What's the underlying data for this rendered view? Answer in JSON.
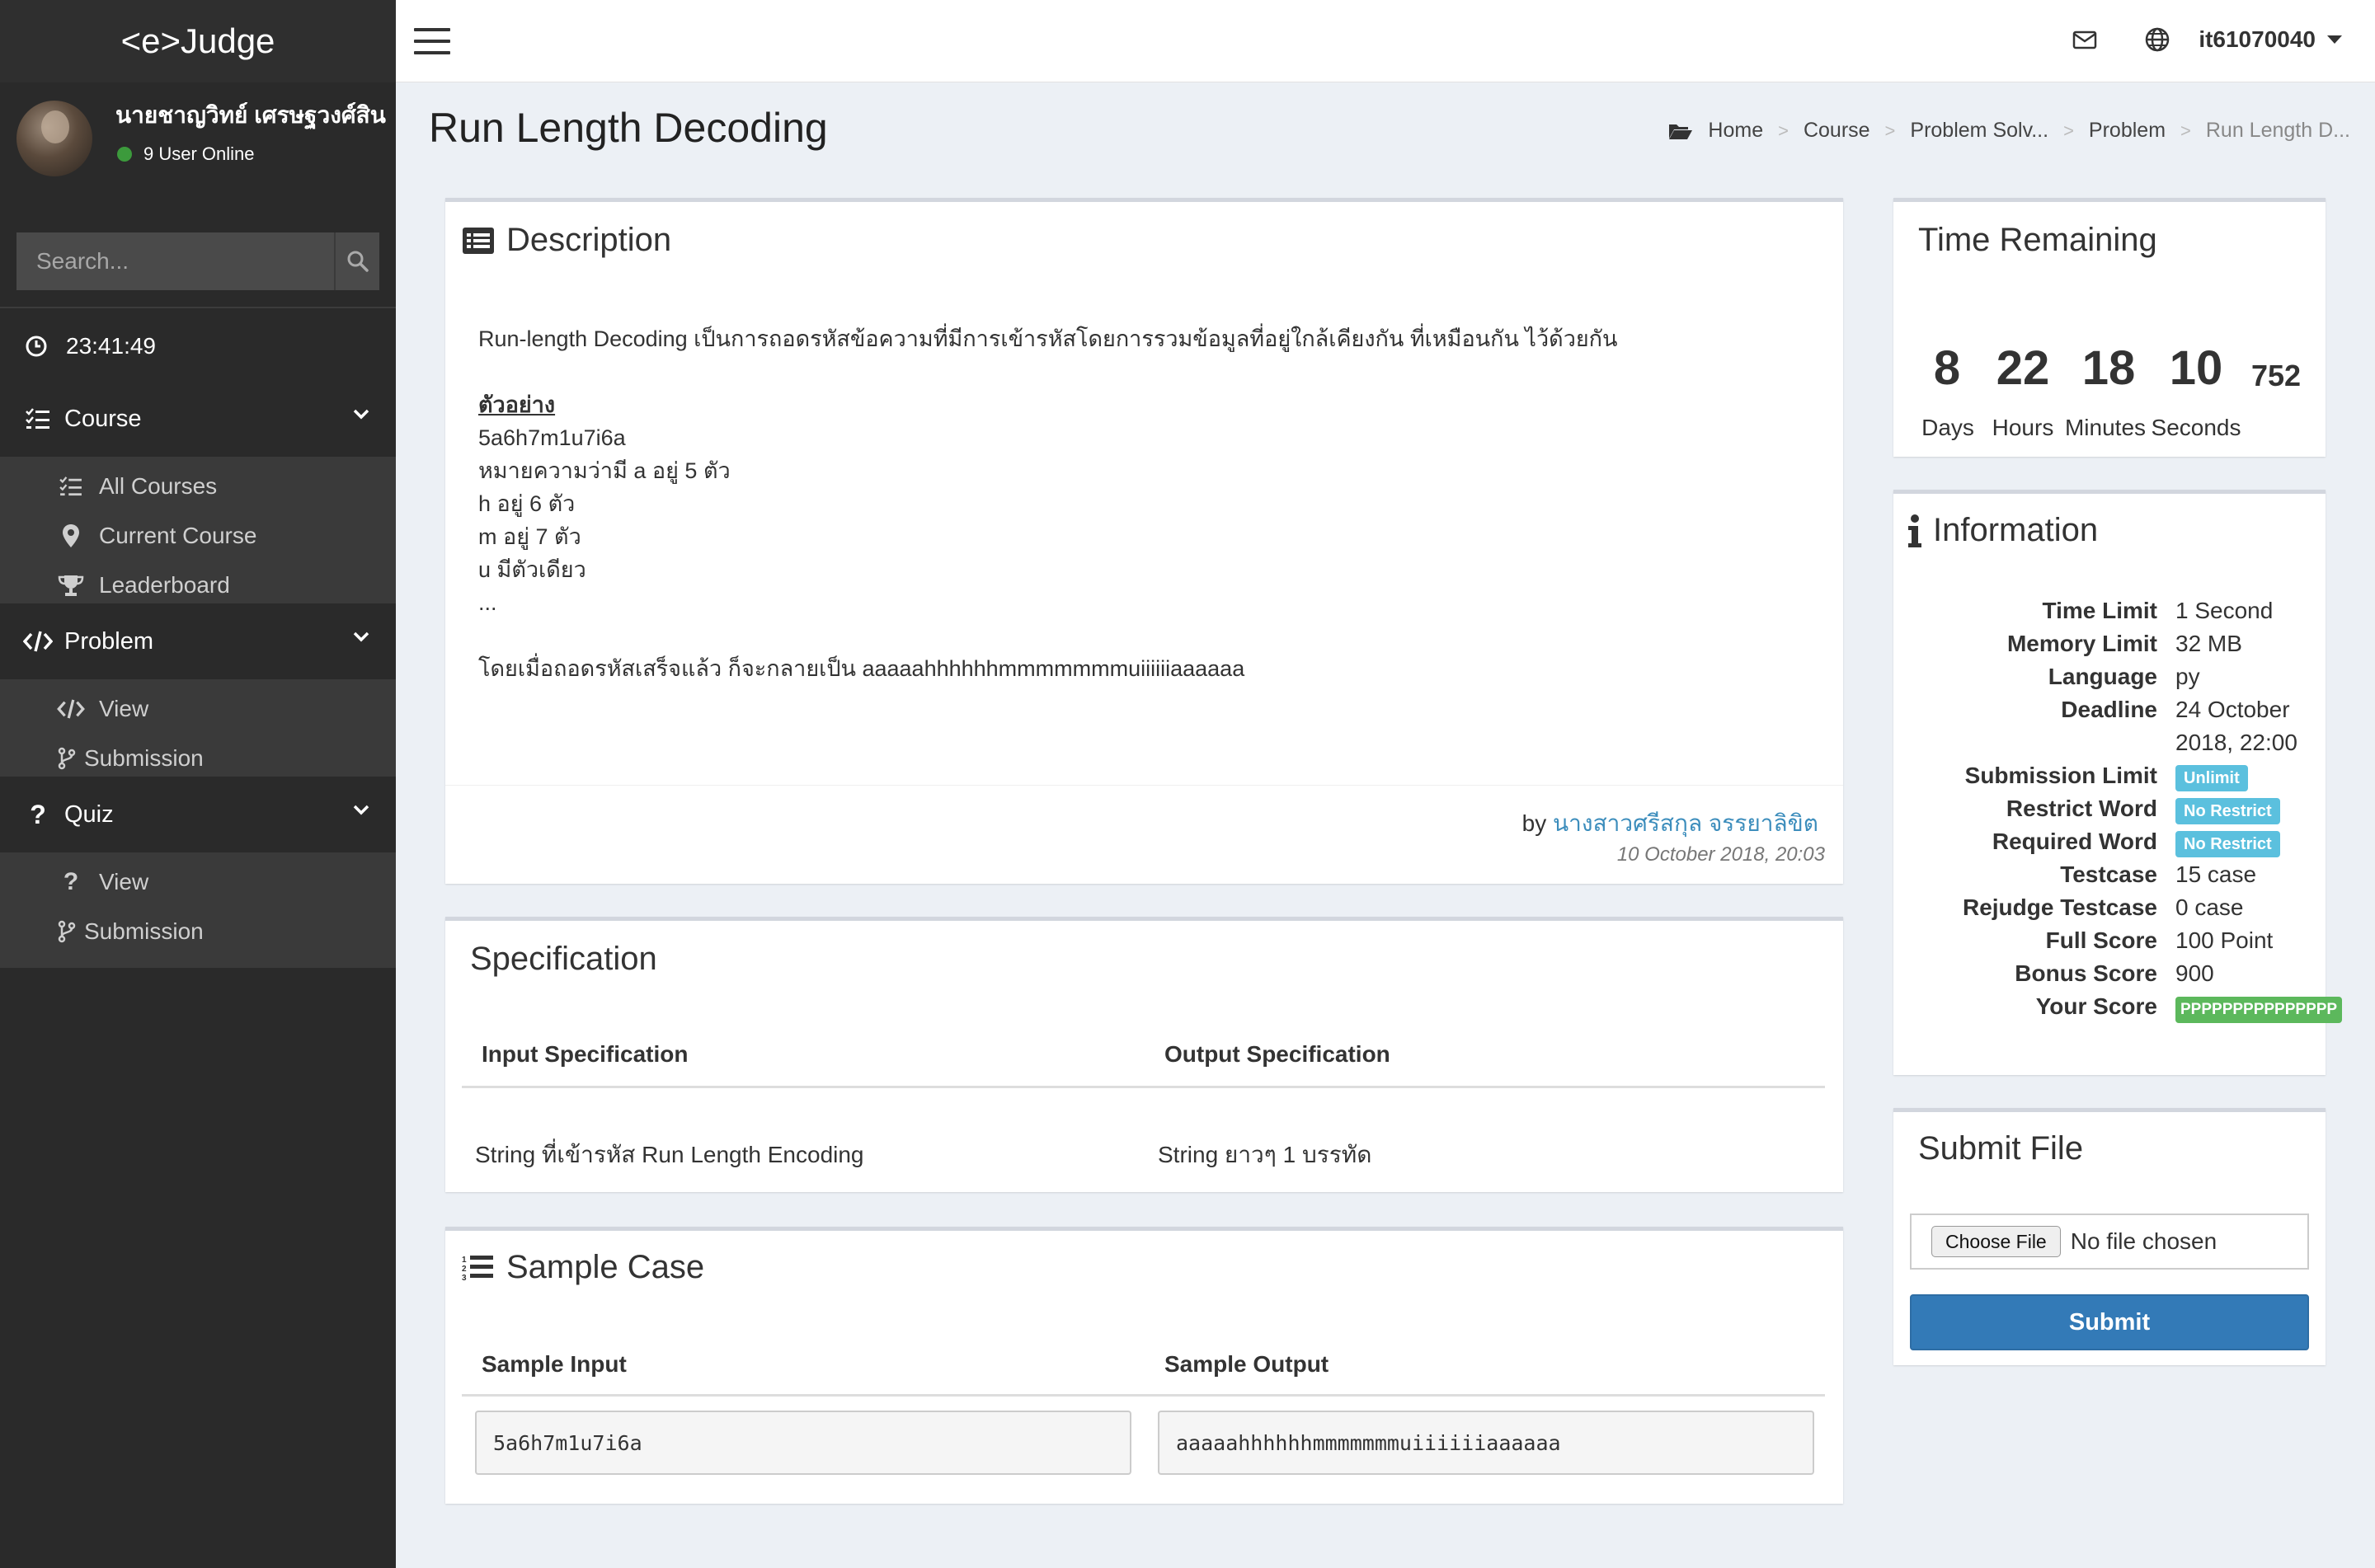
{
  "app": {
    "brand": "<e>Judge"
  },
  "user": {
    "name": "นายชาญวิทย์ เศรษฐวงศ์สิน",
    "online": "9 User Online",
    "username": "it61070040"
  },
  "search": {
    "placeholder": "Search..."
  },
  "clock": {
    "time": "23:41:49"
  },
  "menu": {
    "course": {
      "label": "Course",
      "items": [
        "All Courses",
        "Current Course",
        "Leaderboard"
      ]
    },
    "problem": {
      "label": "Problem",
      "items": [
        "View",
        "Submission"
      ]
    },
    "quiz": {
      "label": "Quiz",
      "items": [
        "View",
        "Submission"
      ]
    }
  },
  "page": {
    "title": "Run Length Decoding"
  },
  "breadcrumb": [
    "Home",
    "Course",
    "Problem Solv...",
    "Problem",
    "Run Length D..."
  ],
  "description": {
    "title": "Description",
    "intro": "Run-length Decoding เป็นการถอดรหัสข้อความที่มีการเข้ารหัสโดยการรวมข้อมูลที่อยู่ใกล้เคียงกัน ที่เหมือนกัน ไว้ด้วยกัน",
    "example_heading": "ตัวอย่าง",
    "lines": [
      "5a6h7m1u7i6a",
      "หมายความว่ามี a อยู่ 5 ตัว",
      "h อยู่ 6 ตัว",
      "m อยู่ 7 ตัว",
      "u มีตัวเดียว",
      "..."
    ],
    "conclusion": "โดยเมื่อถอดรหัสเสร็จแล้ว ก็จะกลายเป็น aaaaahhhhhhmmmmmmmuiiiiiiaaaaaa",
    "by_prefix": "by",
    "author": "นางสาวศรีสกุล จรรยาลิขิต",
    "date": "10 October 2018, 20:03"
  },
  "specification": {
    "title": "Specification",
    "input_header": "Input Specification",
    "output_header": "Output Specification",
    "input": "String ที่เข้ารหัส Run Length Encoding",
    "output": "String ยาวๆ 1 บรรทัด"
  },
  "sample": {
    "title": "Sample Case",
    "input_header": "Sample Input",
    "output_header": "Sample Output",
    "input": "5a6h7m1u7i6a",
    "output": "aaaaahhhhhhmmmmmmmuiiiiiiaaaaaa"
  },
  "time_remaining": {
    "title": "Time Remaining",
    "days": "8",
    "hours": "22",
    "minutes": "18",
    "seconds": "10",
    "ms": "752",
    "days_label": "Days",
    "hours_label": "Hours",
    "minutes_label": "Minutes",
    "seconds_label": "Seconds"
  },
  "information": {
    "title": "Information",
    "rows": [
      {
        "key": "Time Limit",
        "value": "1 Second"
      },
      {
        "key": "Memory Limit",
        "value": "32 MB"
      },
      {
        "key": "Language",
        "value": "py"
      },
      {
        "key": "Deadline",
        "value": "24 October",
        "value2": "2018, 22:00"
      },
      {
        "key": "Submission Limit",
        "badge": "Unlimit",
        "color": "#5bc0de"
      },
      {
        "key": "Restrict Word",
        "badge": "No Restrict",
        "color": "#5bc0de"
      },
      {
        "key": "Required Word",
        "badge": "No Restrict",
        "color": "#5bc0de"
      },
      {
        "key": "Testcase",
        "value": "15 case"
      },
      {
        "key": "Rejudge Testcase",
        "value": "0 case"
      },
      {
        "key": "Full Score",
        "value": "100 Point"
      },
      {
        "key": "Bonus Score",
        "value": "900"
      },
      {
        "key": "Your Score",
        "badge": "PPPPPPPPPPPPPPP",
        "color": "#5cb85c"
      }
    ]
  },
  "submit": {
    "title": "Submit File",
    "choose_label": "Choose File",
    "no_file": "No file chosen",
    "submit_label": "Submit"
  },
  "colors": {
    "sidebar": "#2a2a2a",
    "primary": "#337ab7",
    "info": "#5bc0de",
    "success": "#5cb85c",
    "link": "#3c8dbc"
  }
}
